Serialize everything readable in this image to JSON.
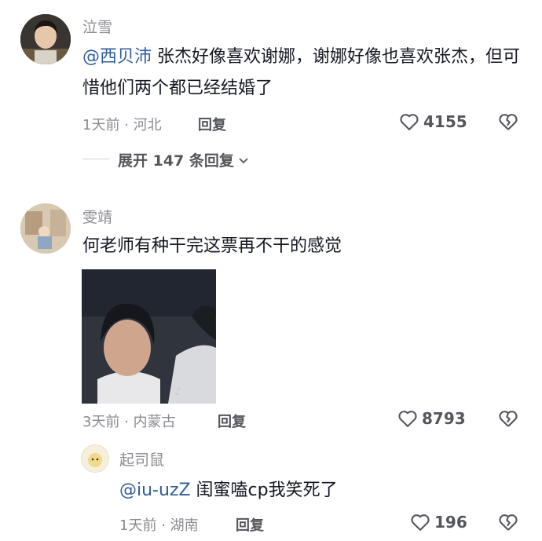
{
  "comments": [
    {
      "author": "泣雪",
      "mention": "@西贝沛",
      "text": " 张杰好像喜欢谢娜，谢娜好像也喜欢张杰，但可惜他们两个都已经结婚了",
      "meta": "1天前 · 河北",
      "reply_label": "回复",
      "likes": "4155",
      "expand_label": "展开 147 条回复"
    },
    {
      "author": "雯靖",
      "text": "何老师有种干完这票再不干的感觉",
      "meta": "3天前 · 内蒙古",
      "reply_label": "回复",
      "likes": "8793",
      "sub_reply": {
        "author": "起司鼠",
        "mention": "@iu-uzZ",
        "text": " 闺蜜嗑cp我笑死了",
        "meta": "1天前 · 湖南",
        "reply_label": "回复",
        "likes": "196"
      }
    }
  ]
}
